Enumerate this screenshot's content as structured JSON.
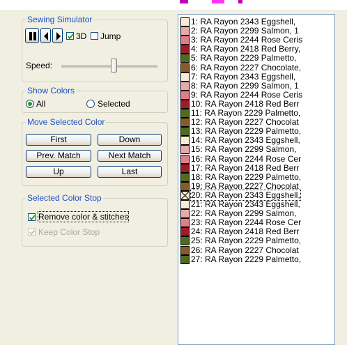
{
  "top_strip_marks": [
    "#c000c0",
    "#ff33ff",
    "#c000c0"
  ],
  "sewing_simulator": {
    "title": "Sewing Simulator",
    "pause_icon": "pause-icon",
    "prev_icon": "step-back-icon",
    "next_icon": "step-forward-icon",
    "three_d_label": "3D",
    "three_d_checked": true,
    "jump_label": "Jump",
    "jump_checked": false,
    "speed_label": "Speed:",
    "speed_value": 0.55
  },
  "show_colors": {
    "title": "Show Colors",
    "all_label": "All",
    "selected_label": "Selected",
    "selected_option": "All"
  },
  "move_selected_color": {
    "title": "Move Selected Color",
    "first": "First",
    "down": "Down",
    "prev_match": "Prev. Match",
    "next_match": "Next Match",
    "up": "Up",
    "last": "Last"
  },
  "selected_color_stop": {
    "title": "Selected Color Stop",
    "remove_label": "Remove color & stitches",
    "remove_checked": true,
    "keep_label": "Keep Color Stop",
    "keep_checked": true,
    "keep_disabled": true
  },
  "color_list": [
    {
      "text": "1: RA Rayon 2343 Eggshell,",
      "color": "#f4ecd8"
    },
    {
      "text": "2: RA Rayon 2299 Salmon,  1",
      "color": "#e8aaa8"
    },
    {
      "text": "3: RA Rayon 2244 Rose Ceris",
      "color": "#e27c8d"
    },
    {
      "text": "4: RA Rayon 2418 Red Berry,",
      "color": "#a01a2a"
    },
    {
      "text": "5: RA Rayon 2229 Palmetto,",
      "color": "#4e6b1e"
    },
    {
      "text": "6: RA Rayon 2227 Chocolate,",
      "color": "#8a5a2a"
    },
    {
      "text": "7: RA Rayon 2343 Eggshell,",
      "color": "#f4ecd8"
    },
    {
      "text": "8: RA Rayon 2299 Salmon,  1",
      "color": "#e8aaa8"
    },
    {
      "text": "9: RA Rayon 2244 Rose Ceris",
      "color": "#e27c8d"
    },
    {
      "text": "10: RA Rayon 2418 Red Berr",
      "color": "#a01a2a"
    },
    {
      "text": "11: RA Rayon 2229 Palmetto,",
      "color": "#4e6b1e"
    },
    {
      "text": "12: RA Rayon 2227 Chocolat",
      "color": "#8a5a2a"
    },
    {
      "text": "13: RA Rayon 2229 Palmetto,",
      "color": "#4e6b1e"
    },
    {
      "text": "14: RA Rayon 2343 Eggshell,",
      "color": "#f4ecd8"
    },
    {
      "text": "15: RA Rayon 2299 Salmon,",
      "color": "#e8aaa8"
    },
    {
      "text": "16: RA Rayon 2244 Rose Cer",
      "color": "#e27c8d"
    },
    {
      "text": "17: RA Rayon 2418 Red Berr",
      "color": "#a01a2a"
    },
    {
      "text": "18: RA Rayon 2229 Palmetto,",
      "color": "#4e6b1e"
    },
    {
      "text": "19: RA Rayon 2227 Chocolat",
      "color": "#8a5a2a"
    },
    {
      "text": "20: RA Rayon 2343 Eggshell,",
      "color": "#f4ecd8",
      "removed": true,
      "current": true
    },
    {
      "text": "21: RA Rayon 2343 Eggshell,",
      "color": "#f4ecd8"
    },
    {
      "text": "22: RA Rayon 2299 Salmon,",
      "color": "#e8aaa8"
    },
    {
      "text": "23: RA Rayon 2244 Rose Cer",
      "color": "#e27c8d"
    },
    {
      "text": "24: RA Rayon 2418 Red Berr",
      "color": "#a01a2a"
    },
    {
      "text": "25: RA Rayon 2229 Palmetto,",
      "color": "#4e6b1e"
    },
    {
      "text": "26: RA Rayon 2227 Chocolat",
      "color": "#8a5a2a"
    },
    {
      "text": "27: RA Rayon 2229 Palmetto,",
      "color": "#4e6b1e"
    }
  ]
}
